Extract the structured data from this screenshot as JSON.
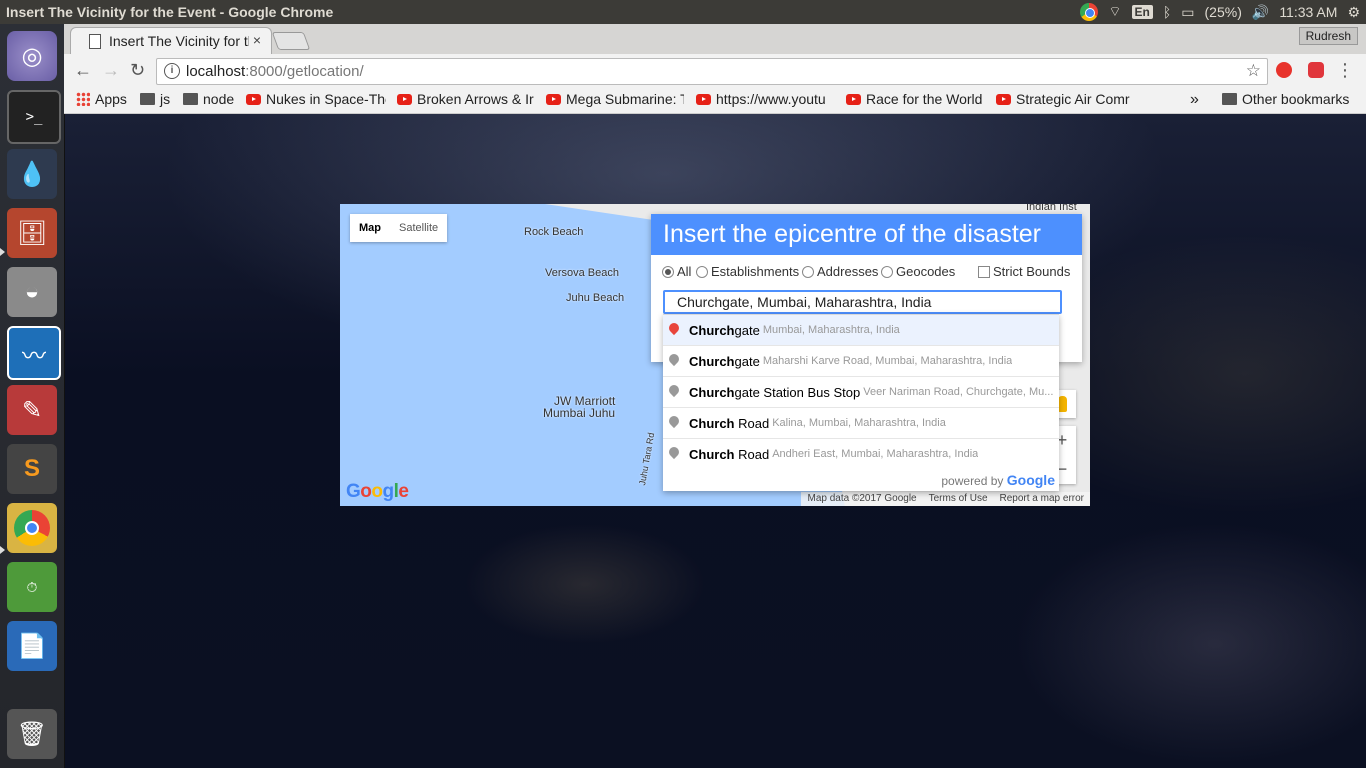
{
  "system": {
    "window_title": "Insert The Vicinity for the Event - Google Chrome",
    "lang": "En",
    "battery": "(25%)",
    "clock": "11:33 AM"
  },
  "browser": {
    "tab_title": "Insert The Vicinity for the Event",
    "tab_close": "×",
    "user": "Rudresh",
    "url_host": "localhost",
    "url_rest": ":8000/getlocation/",
    "bookmarks": [
      {
        "label": "Apps",
        "icon": "apps-icon"
      },
      {
        "label": "js",
        "icon": "folder-icon"
      },
      {
        "label": "node",
        "icon": "folder-icon"
      },
      {
        "label": "Nukes in Space-The",
        "icon": "youtube-icon"
      },
      {
        "label": "Broken Arrows & Ir",
        "icon": "youtube-icon"
      },
      {
        "label": "Mega Submarine: T",
        "icon": "youtube-icon"
      },
      {
        "label": "https://www.youtu",
        "icon": "youtube-icon"
      },
      {
        "label": "Race for the World",
        "icon": "youtube-icon"
      },
      {
        "label": "Strategic Air Comr",
        "icon": "youtube-icon"
      }
    ],
    "bookmarks_overflow": "»",
    "other_bookmarks": "Other bookmarks"
  },
  "map": {
    "type_map": "Map",
    "type_satellite": "Satellite",
    "labels": {
      "rock_beach": "Rock Beach",
      "versova": "Versova Beach",
      "juhu": "Juhu Beach",
      "jw1": "JW Marriott",
      "jw2": "Mumbai Juhu",
      "juhu_tara": "Juhu Tara Rd",
      "indian_inst": "Indian Inst"
    },
    "logo": "Google",
    "footer": {
      "data": "Map data ©2017 Google",
      "terms": "Terms of Use",
      "report": "Report a map error"
    },
    "zoom_in": "+",
    "zoom_out": "−"
  },
  "card": {
    "heading": "Insert the epicentre of the disaster",
    "options": {
      "all": "All",
      "establishments": "Establishments",
      "addresses": "Addresses",
      "geocodes": "Geocodes",
      "strict": "Strict Bounds"
    },
    "selected_option": "All",
    "search_value": "Churchgate, Mumbai, Maharashtra, India"
  },
  "autocomplete": [
    {
      "match": "Church",
      "rest": "gate",
      "secondary": "Mumbai, Maharashtra, India"
    },
    {
      "match": "Church",
      "rest": "gate",
      "secondary": "Maharshi Karve Road, Mumbai, Maharashtra, India"
    },
    {
      "match": "Church",
      "rest": "gate Station Bus Stop",
      "secondary": "Veer Nariman Road, Churchgate, Mu..."
    },
    {
      "match": "Church",
      "rest": " Road",
      "secondary": "Kalina, Mumbai, Maharashtra, India"
    },
    {
      "match": "Church",
      "rest": " Road",
      "secondary": "Andheri East, Mumbai, Maharashtra, India"
    }
  ],
  "powered_by": "powered by",
  "powered_brand": "Google"
}
